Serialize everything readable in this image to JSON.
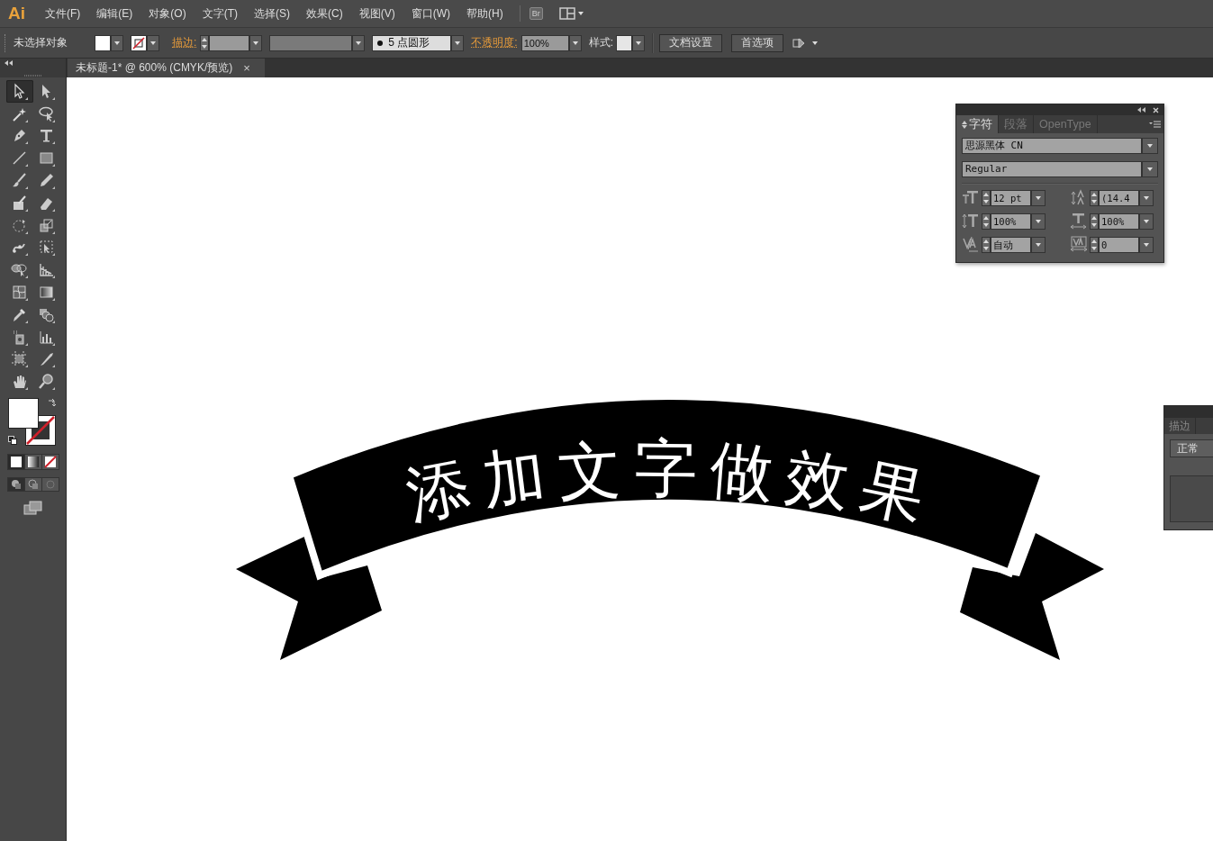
{
  "app": {
    "logo": "Ai",
    "bridge_button": "Br"
  },
  "menu": [
    "文件(F)",
    "编辑(E)",
    "对象(O)",
    "文字(T)",
    "选择(S)",
    "效果(C)",
    "视图(V)",
    "窗口(W)",
    "帮助(H)"
  ],
  "control_bar": {
    "selection": "未选择对象",
    "stroke_label": "描边:",
    "brush": "5 点圆形",
    "opacity_label": "不透明度:",
    "opacity": "100%",
    "style_label": "样式:",
    "buttons": [
      "文档设置",
      "首选项"
    ]
  },
  "document_tab": {
    "title": "未标题-1* @ 600% (CMYK/预览)",
    "close": "×"
  },
  "tools": [
    {
      "selected": true
    },
    {
      "selected": false
    },
    {
      "selected": false
    },
    {
      "selected": false
    },
    {
      "selected": false
    },
    {
      "selected": false
    },
    {
      "selected": false
    },
    {
      "selected": false
    },
    {
      "selected": false
    },
    {
      "selected": false
    },
    {
      "selected": false
    },
    {
      "selected": false
    },
    {
      "selected": false
    },
    {
      "selected": false
    },
    {
      "selected": false
    },
    {
      "selected": false
    },
    {
      "selected": false
    },
    {
      "selected": false
    },
    {
      "selected": false
    },
    {
      "selected": false
    },
    {
      "selected": false
    },
    {
      "selected": false
    },
    {
      "selected": false
    },
    {
      "selected": false
    },
    {
      "selected": false
    },
    {
      "selected": false
    },
    {
      "selected": false
    },
    {
      "selected": false
    }
  ],
  "character_panel": {
    "tabs": [
      {
        "label": "字符",
        "selected": true
      },
      {
        "label": "段落",
        "selected": false
      },
      {
        "label": "OpenType",
        "selected": false
      }
    ],
    "font_family": "思源黑体 CN",
    "font_style": "Regular",
    "fields": [
      "12 pt",
      "(14.4",
      "100%",
      "100%",
      "自动",
      "0"
    ]
  },
  "side_panel": {
    "tabs": [
      "描边"
    ],
    "blend_mode": "正常"
  },
  "canvas": {
    "banner_text": "添加文字做效果"
  }
}
